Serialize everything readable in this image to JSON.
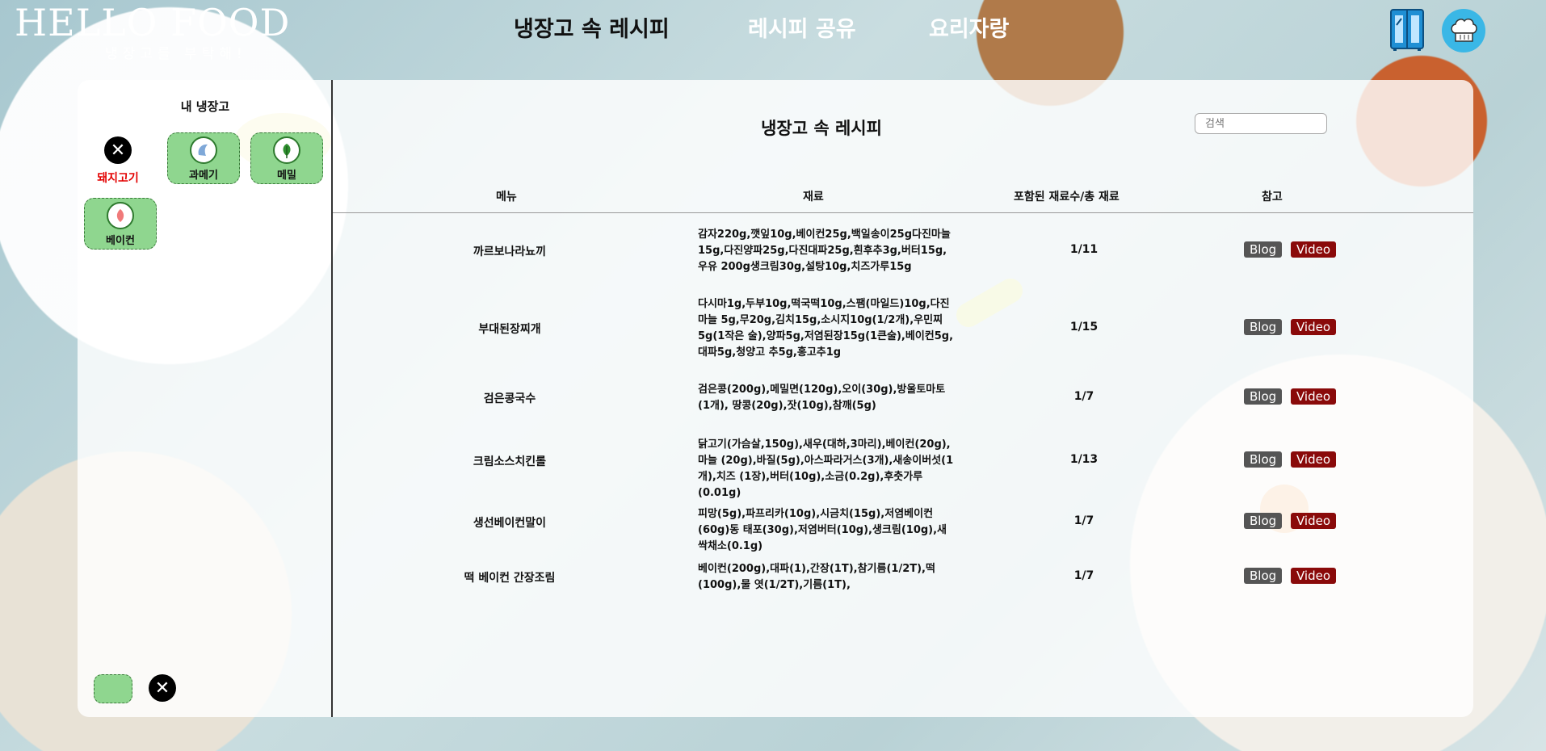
{
  "logo": {
    "main": "HELLO FOOD",
    "sub": "냉장고를 부탁해!"
  },
  "nav": {
    "items": [
      "냉장고 속 레시피",
      "레시피 공유",
      "요리자랑"
    ],
    "active": 0
  },
  "sidebar": {
    "title": "내 냉장고",
    "removed": {
      "label": "돼지고기",
      "icon": "close-icon"
    },
    "ingredients": [
      {
        "label": "과메기",
        "icon": "fish-icon"
      },
      {
        "label": "메밀",
        "icon": "leaf-icon"
      },
      {
        "label": "베이컨",
        "icon": "meat-icon"
      }
    ]
  },
  "main": {
    "title": "냉장고 속 레시피",
    "search_placeholder": "검색",
    "columns": [
      "메뉴",
      "재료",
      "포함된 재료수/총 재료",
      "참고"
    ],
    "blog_label": "Blog",
    "video_label": "Video",
    "rows": [
      {
        "menu": "까르보나라뇨끼",
        "ingredients": "감자220g,깻잎10g,베이컨25g,백일송이25g다진마늘 15g,다진양파25g,다진대파25g,흰후추3g,버터15g,우유 200g생크림30g,설탕10g,치즈가루15g",
        "count": "1/11"
      },
      {
        "menu": "부대된장찌개",
        "ingredients": "다시마1g,두부10g,떡국떡10g,스팸(마일드)10g,다진마늘 5g,무20g,김치15g,소시지10g(1/2개),우민찌5g(1작은 술),양파5g,저염된장15g(1큰술),베이컨5g,대파5g,청양고 추5g,홍고추1g",
        "count": "1/15"
      },
      {
        "menu": "검은콩국수",
        "ingredients": "검은콩(200g),메밀면(120g),오이(30g),방울토마토(1개), 땅콩(20g),잣(10g),참깨(5g)",
        "count": "1/7"
      },
      {
        "menu": "크림소스치킨롤",
        "ingredients": "닭고기(가슴살,150g),새우(대하,3마리),베이컨(20g),마늘 (20g),바질(5g),아스파라거스(3개),새송이버섯(1개),치즈 (1장),버터(10g),소금(0.2g),후춧가루(0.01g)",
        "count": "1/13"
      },
      {
        "menu": "생선베이컨말이",
        "ingredients": "피망(5g),파프리카(10g),시금치(15g),저염베이컨(60g)동 태포(30g),저염버터(10g),생크림(10g),새싹채소(0.1g)",
        "count": "1/7"
      },
      {
        "menu": "떡 베이컨 간장조림",
        "ingredients": "베이컨(200g),대파(1),간장(1T),참기름(1/2T),떡(100g),물 엿(1/2T),기름(1T),",
        "count": "1/7"
      }
    ]
  },
  "colors": {
    "accent_green": "#8fd68f",
    "video_red": "#8a0a0a",
    "blog_gray": "#555555",
    "removed_red": "#e30000",
    "chef_blue": "#3ab7e6"
  }
}
